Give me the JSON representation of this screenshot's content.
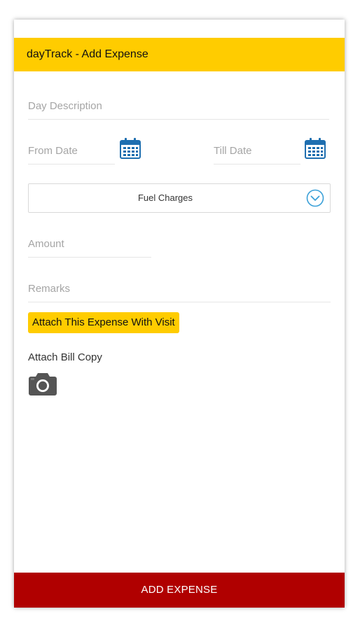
{
  "appbar": {
    "title": "dayTrack - Add Expense",
    "color": "#ffcc00"
  },
  "form": {
    "day_description_placeholder": "Day Description",
    "from_date_placeholder": "From Date",
    "till_date_placeholder": "Till Date",
    "expense_type_selected": "Fuel Charges",
    "amount_placeholder": "Amount",
    "remarks_placeholder": "Remarks"
  },
  "actions": {
    "attach_visit_label": "Attach This Expense With Visit",
    "attach_bill_label": "Attach Bill Copy",
    "add_expense_label": "ADD EXPENSE",
    "add_expense_color": "#b00000"
  },
  "icons": {
    "calendar": "calendar-icon",
    "dropdown": "chevron-down-circle-icon",
    "camera": "camera-icon"
  }
}
